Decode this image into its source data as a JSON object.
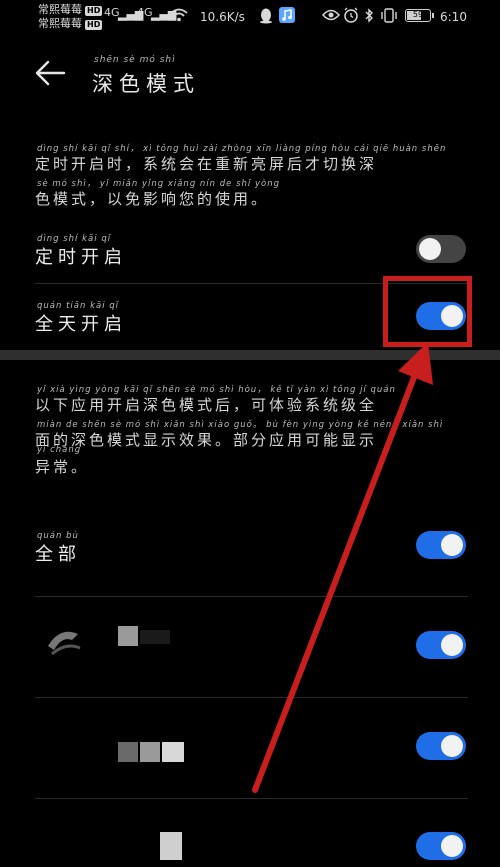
{
  "status_bar": {
    "carrier_top": "常熙莓莓",
    "carrier_bottom": "常熙莓莓",
    "hd": "HD",
    "signal_1": "4G",
    "signal_2": "4G",
    "net_speed": "10.6K/s",
    "battery_level": "59",
    "battery_fraction": 0.59,
    "time": "6:10"
  },
  "header": {
    "title": "深色模式",
    "title_pinyin": "shēn  sè  mó  shì"
  },
  "schedule_desc": {
    "pinyin_1": "dìng shí kāi qǐ shí，  xì tǒng huì zài zhòng xīn liàng píng hòu cái qiē huàn shēn",
    "line_1": "定时开启时，系统会在重新亮屏后才切换深",
    "pinyin_2": "sè mó shì，  yǐ miǎn yǐng xiǎng nín de shǐ yòng",
    "line_2": "色模式，以免影响您的使用。"
  },
  "settings": [
    {
      "pinyin": "dìng shí kāi qǐ",
      "label": "定时开启",
      "on": false
    },
    {
      "pinyin": "quán tiān kāi qǐ",
      "label": "全天开启",
      "on": true
    }
  ],
  "apps_desc": {
    "pinyin_1": "yǐ xià yìng yòng kāi qǐ shēn sè mó shì hòu，  kě tǐ yàn xì tǒng jí quán",
    "line_1": "以下应用开启深色模式后，可体验系统级全",
    "pinyin_2": "miàn de shēn sè mó shì xiǎn shì xiào guǒ。  bù fèn yìng yòng kě néng xiǎn shì",
    "line_2": "面的深色模式显示效果。部分应用可能显示",
    "pinyin_3": "yì cháng",
    "line_3": "异常。"
  },
  "all_apps": {
    "pinyin": "quán bù",
    "label": "全部",
    "on": true
  },
  "apps": [
    {
      "on": true
    },
    {
      "on": true
    },
    {
      "on": true
    }
  ],
  "colors": {
    "accent": "#1f6ee8",
    "highlight": "#c81e1e",
    "background": "#000000"
  },
  "icons": [
    "back-arrow-icon",
    "qq-icon",
    "music-icon",
    "eye-icon",
    "alarm-icon",
    "bluetooth-icon",
    "vibrate-icon",
    "battery-icon",
    "wifi-icon"
  ]
}
